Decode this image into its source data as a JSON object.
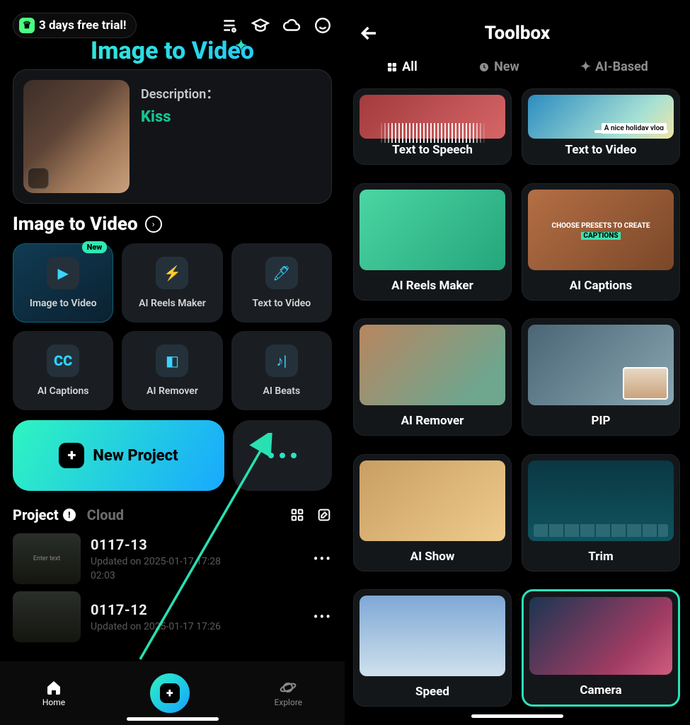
{
  "left": {
    "trial_text": "3 days free trial!",
    "hero_title": "Image to Video",
    "desc": {
      "description_label": "Description：",
      "description_value": "Kiss"
    },
    "section_title": "Image to Video",
    "tool_badge": "New",
    "tools": [
      {
        "label": "Image to Video"
      },
      {
        "label": "AI Reels Maker"
      },
      {
        "label": "Text  to Video"
      },
      {
        "label": "AI Captions"
      },
      {
        "label": "AI Remover"
      },
      {
        "label": "AI Beats"
      }
    ],
    "new_project_label": "New Project",
    "project_tab": "Project",
    "cloud_tab": "Cloud",
    "projects": [
      {
        "name": "0117-13",
        "updated": "Updated on 2025-01-17 17:28",
        "length": "02:03",
        "thumb_text": "Enter text"
      },
      {
        "name": "0117-12",
        "updated": "Updated on 2025-01-17 17:26",
        "length": "",
        "thumb_text": ""
      }
    ],
    "nav": {
      "home": "Home",
      "explore": "Explore"
    }
  },
  "right": {
    "title": "Toolbox",
    "tabs": {
      "all": "All",
      "new": "New",
      "ai": "AI-Based"
    },
    "cards": [
      {
        "label": "Text to Speech"
      },
      {
        "label": "Text  to Video",
        "pill": "A nice holiday vlog"
      },
      {
        "label": "AI Reels Maker"
      },
      {
        "label": "AI Captions",
        "caption": "CHOOSE  PRESETS TO CREATE",
        "caption_pill": "CAPTIONS"
      },
      {
        "label": "AI Remover"
      },
      {
        "label": "PIP"
      },
      {
        "label": "AI Show"
      },
      {
        "label": "Trim"
      },
      {
        "label": "Speed"
      },
      {
        "label": "Camera"
      }
    ]
  }
}
